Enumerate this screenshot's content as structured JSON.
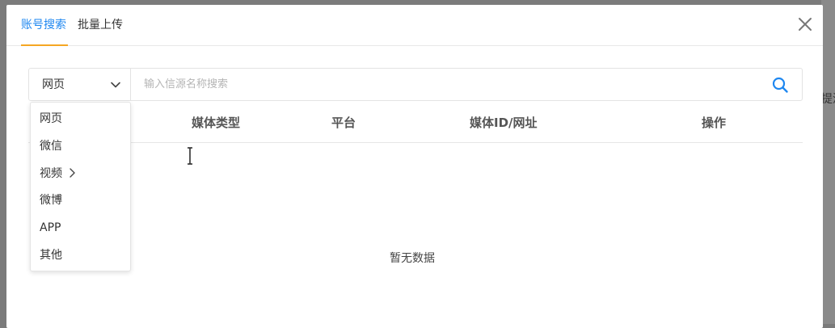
{
  "behind": {
    "text": "提消"
  },
  "tabs": [
    {
      "label": "账号搜索",
      "active": true
    },
    {
      "label": "批量上传",
      "active": false
    }
  ],
  "colors": {
    "accent": "#1e87f0",
    "tab_indicator": "#f5a623"
  },
  "search": {
    "selected_type": "网页",
    "placeholder": "输入信源名称搜索",
    "value": ""
  },
  "table": {
    "columns": [
      "媒体类型",
      "平台",
      "媒体ID/网址",
      "操作"
    ],
    "empty_text": "暂无数据"
  },
  "dropdown": {
    "options": [
      {
        "label": "网页"
      },
      {
        "label": "微信"
      },
      {
        "label": "视频",
        "has_submenu": true
      },
      {
        "label": "微博"
      },
      {
        "label": "APP"
      },
      {
        "label": "其他"
      }
    ]
  },
  "icons": {
    "close": "close-icon",
    "chevron": "chevron-down-icon",
    "search": "search-icon",
    "submenu": "chevron-right-icon"
  }
}
